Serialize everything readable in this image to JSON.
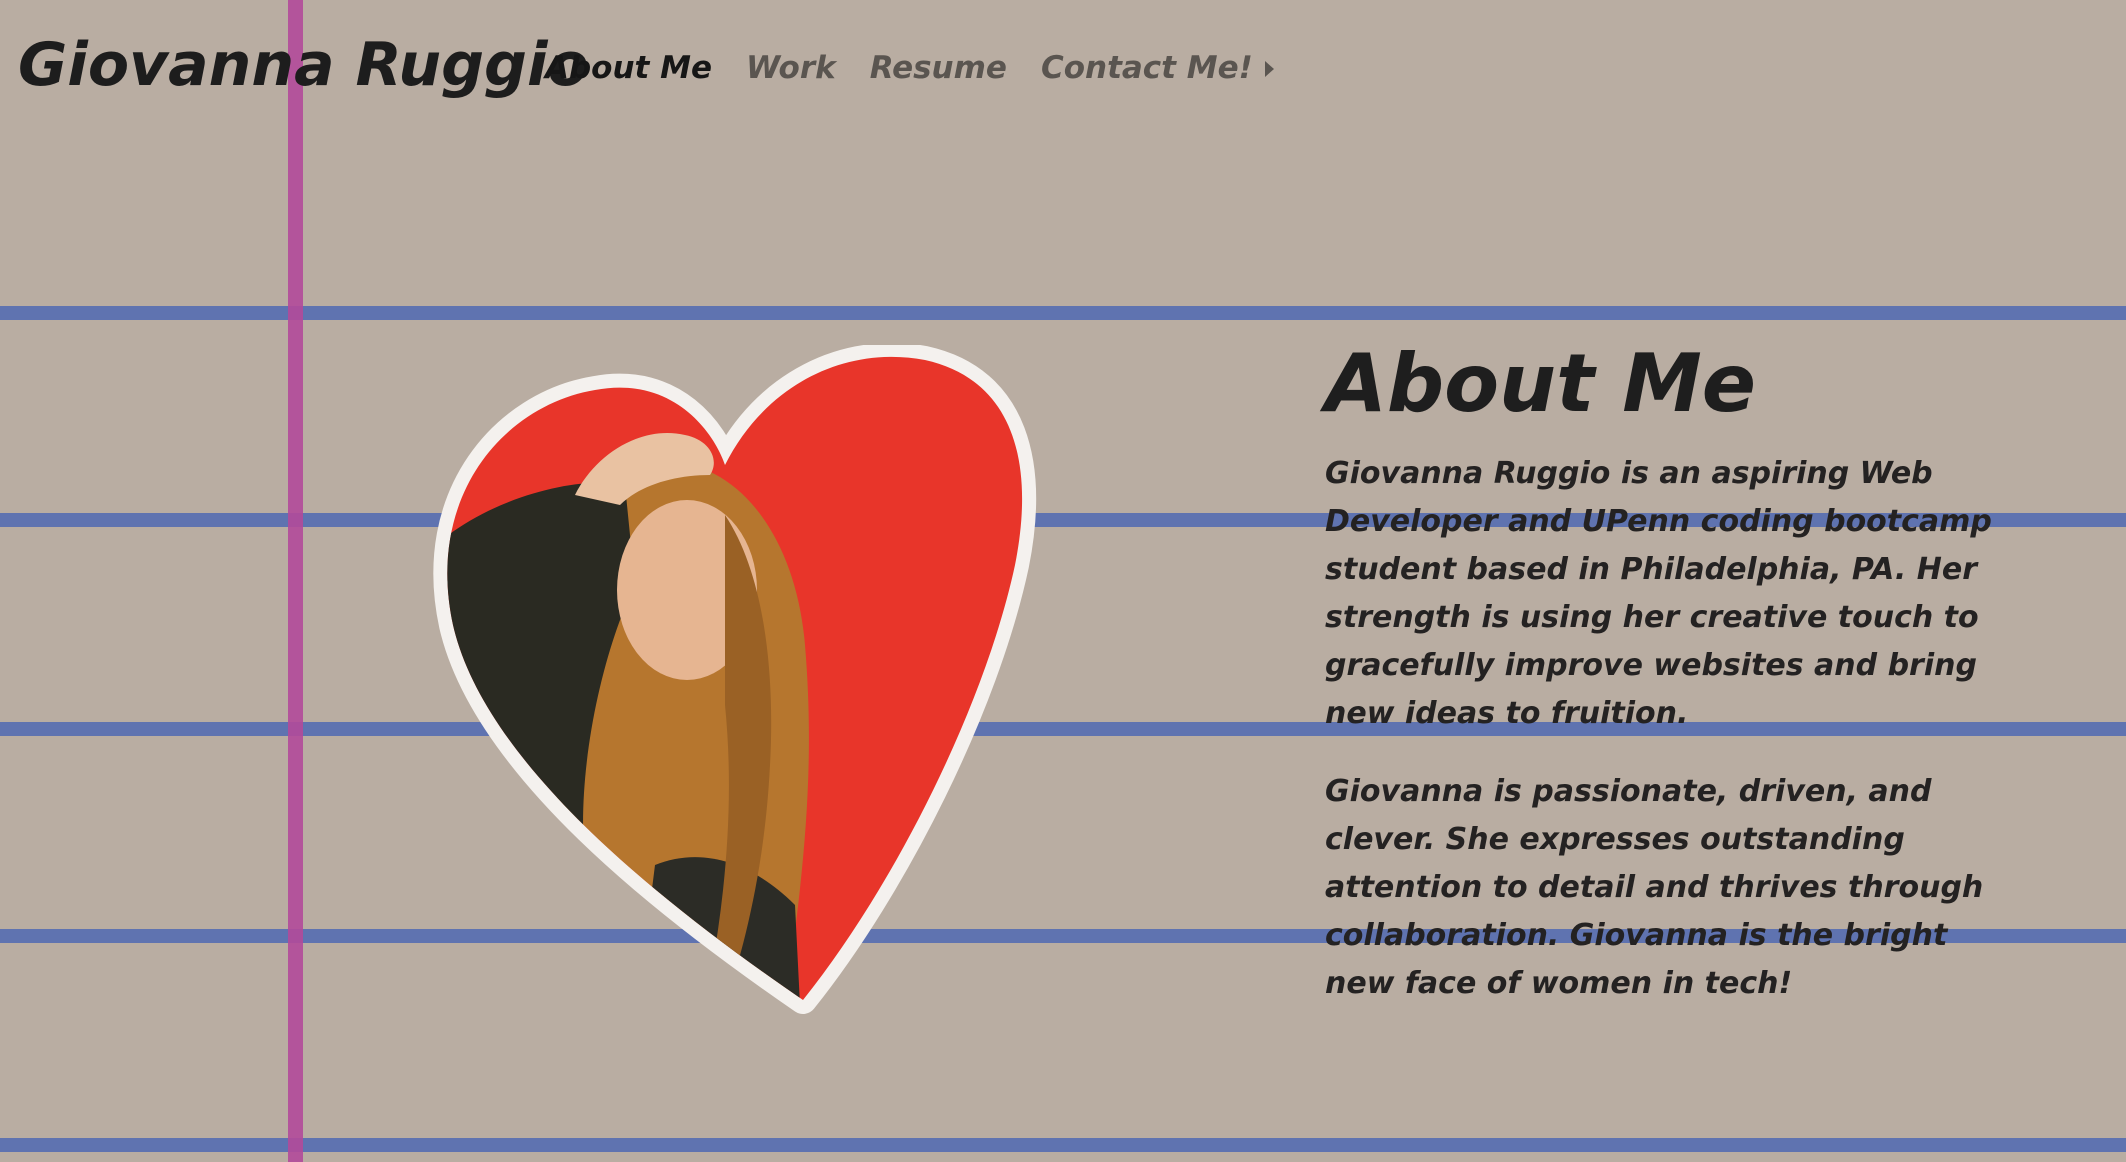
{
  "header": {
    "brand": "Giovanna Ruggio",
    "nav": [
      {
        "label": "About Me",
        "active": true
      },
      {
        "label": "Work",
        "active": false
      },
      {
        "label": "Resume",
        "active": false
      },
      {
        "label": "Contact Me!",
        "active": false,
        "dropdown": true
      }
    ]
  },
  "about": {
    "title": "About Me",
    "paragraphs": [
      "Giovanna Ruggio is an aspiring Web Developer and UPenn coding bootcamp student based in Philadelphia, PA. Her strength is using her creative touch to gracefully improve websites and bring new ideas to fruition.",
      "Giovanna is passionate, driven, and clever. She expresses outstanding attention to detail and thrives through collaboration. Giovanna is the bright new face of women in tech!"
    ]
  },
  "colors": {
    "paper": "#b9ada2",
    "rule_line": "#4f68b3",
    "margin_line": "#b34a9a",
    "heart": "#e8352a",
    "text_dark": "#1e1e1e",
    "nav_inactive": "#5a5550"
  },
  "icons": {
    "dropdown": "caret-right-icon"
  }
}
